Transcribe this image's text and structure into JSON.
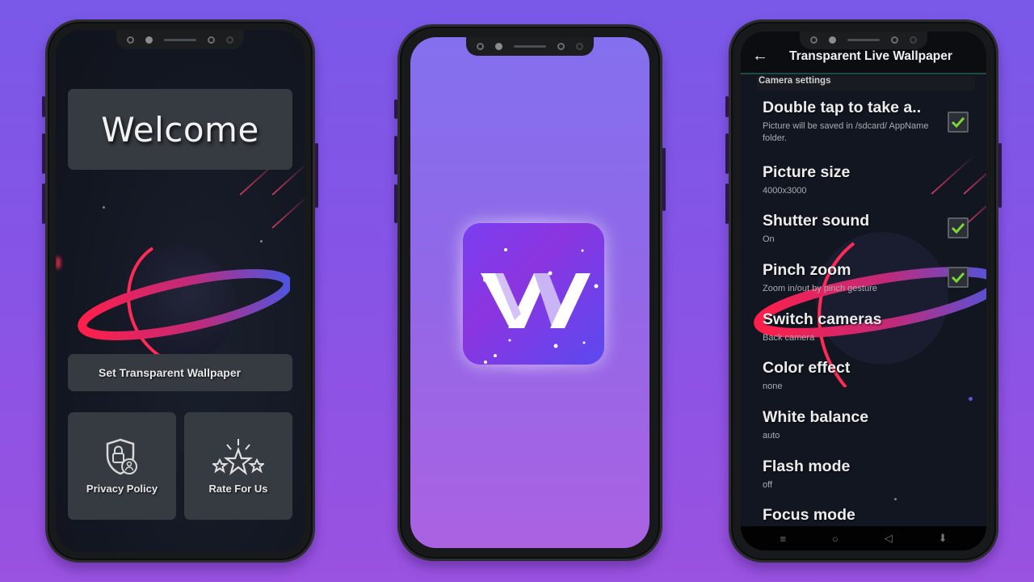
{
  "background": {
    "gradient_top": "#7a59e8",
    "gradient_bottom": "#9a52e0"
  },
  "phone1": {
    "welcome": "Welcome",
    "set_wallpaper_button": "Set Transparent Wallpaper",
    "tiles": [
      {
        "label": "Privacy Policy",
        "icon": "shield-lock-user-icon"
      },
      {
        "label": "Rate For Us",
        "icon": "three-stars-icon"
      }
    ],
    "accent_colors": {
      "ring_start": "#ff1f4a",
      "ring_end": "#4e55e0"
    }
  },
  "phone2": {
    "app_icon": {
      "glyph": "W",
      "semantic": "app-logo-w"
    }
  },
  "phone3": {
    "header": {
      "back_icon": "←",
      "title": "Transparent Live Wallpaper"
    },
    "section_title": "Camera settings",
    "preferences": [
      {
        "title": "Double tap to take a..",
        "summary": "Picture will be saved in /sdcard/ AppName folder.",
        "checkbox": true,
        "checked": true
      },
      {
        "title": "Picture size",
        "summary": "4000x3000",
        "checkbox": false
      },
      {
        "title": "Shutter sound",
        "summary": "On",
        "checkbox": true,
        "checked": true
      },
      {
        "title": "Pinch zoom",
        "summary": "Zoom in/out by pinch gesture",
        "checkbox": true,
        "checked": true
      },
      {
        "title": "Switch cameras",
        "summary": "Back camera",
        "checkbox": false
      },
      {
        "title": "Color effect",
        "summary": "none",
        "checkbox": false
      },
      {
        "title": "White balance",
        "summary": "auto",
        "checkbox": false
      },
      {
        "title": "Flash mode",
        "summary": "off",
        "checkbox": false
      },
      {
        "title": "Focus mode",
        "summary": "",
        "checkbox": false
      }
    ],
    "navbar": {
      "menu": "≡",
      "home": "○",
      "back": "◁",
      "extra": "⬇"
    },
    "check_color": "#7bd83a",
    "header_divider_color": "#1f4a46"
  }
}
